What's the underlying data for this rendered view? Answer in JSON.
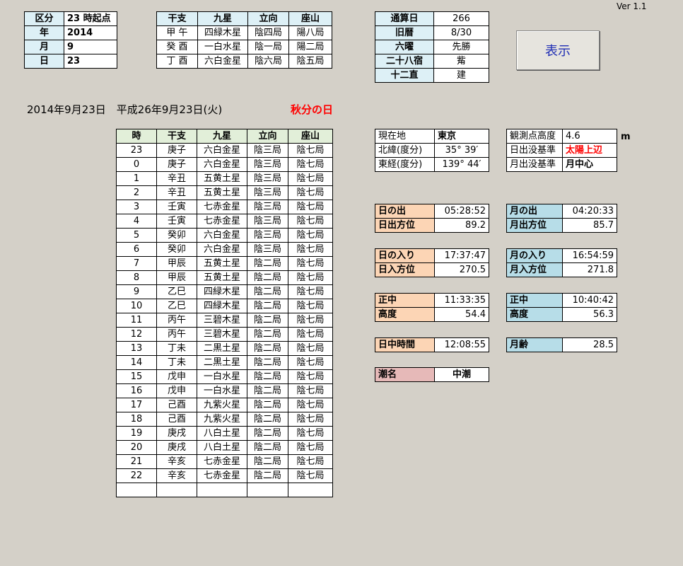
{
  "version": "Ver 1.1",
  "input": {
    "kubun_label": "区分",
    "kubun_value": "23 時起点",
    "year_label": "年",
    "year_value": "2014",
    "month_label": "月",
    "month_value": "9",
    "day_label": "日",
    "day_value": "23"
  },
  "kanshi_table": {
    "headers": [
      "干支",
      "九星",
      "立向",
      "座山"
    ],
    "rows": [
      [
        "甲 午",
        "四緑木星",
        "陰四局",
        "陽八局"
      ],
      [
        "癸 酉",
        "一白水星",
        "陰一局",
        "陽二局"
      ],
      [
        "丁 酉",
        "六白金星",
        "陰六局",
        "陰五局"
      ]
    ]
  },
  "calendar_info": {
    "rows": [
      {
        "label": "通算日",
        "value": "266"
      },
      {
        "label": "旧暦",
        "value": "8/30"
      },
      {
        "label": "六曜",
        "value": "先勝"
      },
      {
        "label": "二十八宿",
        "value": "觜"
      },
      {
        "label": "十二直",
        "value": "建"
      }
    ]
  },
  "show_button_label": "表示",
  "date_line": "2014年9月23日　平成26年9月23日(火)",
  "holiday": "秋分の日",
  "hourly": {
    "headers": [
      "時",
      "干支",
      "九星",
      "立向",
      "座山"
    ],
    "rows": [
      [
        "23",
        "庚子",
        "六白金星",
        "陰三局",
        "陰七局"
      ],
      [
        "0",
        "庚子",
        "六白金星",
        "陰三局",
        "陰七局"
      ],
      [
        "1",
        "辛丑",
        "五黄土星",
        "陰三局",
        "陰七局"
      ],
      [
        "2",
        "辛丑",
        "五黄土星",
        "陰三局",
        "陰七局"
      ],
      [
        "3",
        "壬寅",
        "七赤金星",
        "陰三局",
        "陰七局"
      ],
      [
        "4",
        "壬寅",
        "七赤金星",
        "陰三局",
        "陰七局"
      ],
      [
        "5",
        "癸卯",
        "六白金星",
        "陰三局",
        "陰七局"
      ],
      [
        "6",
        "癸卯",
        "六白金星",
        "陰三局",
        "陰七局"
      ],
      [
        "7",
        "甲辰",
        "五黄土星",
        "陰二局",
        "陰七局"
      ],
      [
        "8",
        "甲辰",
        "五黄土星",
        "陰二局",
        "陰七局"
      ],
      [
        "9",
        "乙巳",
        "四緑木星",
        "陰二局",
        "陰七局"
      ],
      [
        "10",
        "乙巳",
        "四緑木星",
        "陰二局",
        "陰七局"
      ],
      [
        "11",
        "丙午",
        "三碧木星",
        "陰二局",
        "陰七局"
      ],
      [
        "12",
        "丙午",
        "三碧木星",
        "陰二局",
        "陰七局"
      ],
      [
        "13",
        "丁未",
        "二黒土星",
        "陰二局",
        "陰七局"
      ],
      [
        "14",
        "丁未",
        "二黒土星",
        "陰二局",
        "陰七局"
      ],
      [
        "15",
        "戊申",
        "一白水星",
        "陰二局",
        "陰七局"
      ],
      [
        "16",
        "戊申",
        "一白水星",
        "陰二局",
        "陰七局"
      ],
      [
        "17",
        "己酉",
        "九紫火星",
        "陰二局",
        "陰七局"
      ],
      [
        "18",
        "己酉",
        "九紫火星",
        "陰二局",
        "陰七局"
      ],
      [
        "19",
        "庚戌",
        "八白土星",
        "陰二局",
        "陰七局"
      ],
      [
        "20",
        "庚戌",
        "八白土星",
        "陰二局",
        "陰七局"
      ],
      [
        "21",
        "辛亥",
        "七赤金星",
        "陰二局",
        "陰七局"
      ],
      [
        "22",
        "辛亥",
        "七赤金星",
        "陰二局",
        "陰七局"
      ],
      [
        "",
        "",
        "",
        "",
        ""
      ]
    ]
  },
  "location": {
    "current_label": "現在地",
    "current_value": "東京",
    "lat_label": "北緯(度分)",
    "lat_value": "35° 39′",
    "lon_label": "東経(度分)",
    "lon_value": "139° 44′"
  },
  "observation": {
    "height_label": "観測点高度",
    "height_value": "4.6",
    "height_unit": "m",
    "sun_basis_label": "日出没基準",
    "sun_basis_value": "太陽上辺",
    "moon_basis_label": "月出没基準",
    "moon_basis_value": "月中心"
  },
  "sun": {
    "rise_label": "日の出",
    "rise_value": "05:28:52",
    "rise_az_label": "日出方位",
    "rise_az_value": "89.2",
    "set_label": "日の入り",
    "set_value": "17:37:47",
    "set_az_label": "日入方位",
    "set_az_value": "270.5",
    "transit_label": "正中",
    "transit_value": "11:33:35",
    "alt_label": "高度",
    "alt_value": "54.4",
    "daylight_label": "日中時間",
    "daylight_value": "12:08:55"
  },
  "moon": {
    "rise_label": "月の出",
    "rise_value": "04:20:33",
    "rise_az_label": "月出方位",
    "rise_az_value": "85.7",
    "set_label": "月の入り",
    "set_value": "16:54:59",
    "set_az_label": "月入方位",
    "set_az_value": "271.8",
    "transit_label": "正中",
    "transit_value": "10:40:42",
    "alt_label": "高度",
    "alt_value": "56.3",
    "age_label": "月齢",
    "age_value": "28.5"
  },
  "tide": {
    "label": "潮名",
    "value": "中潮"
  }
}
